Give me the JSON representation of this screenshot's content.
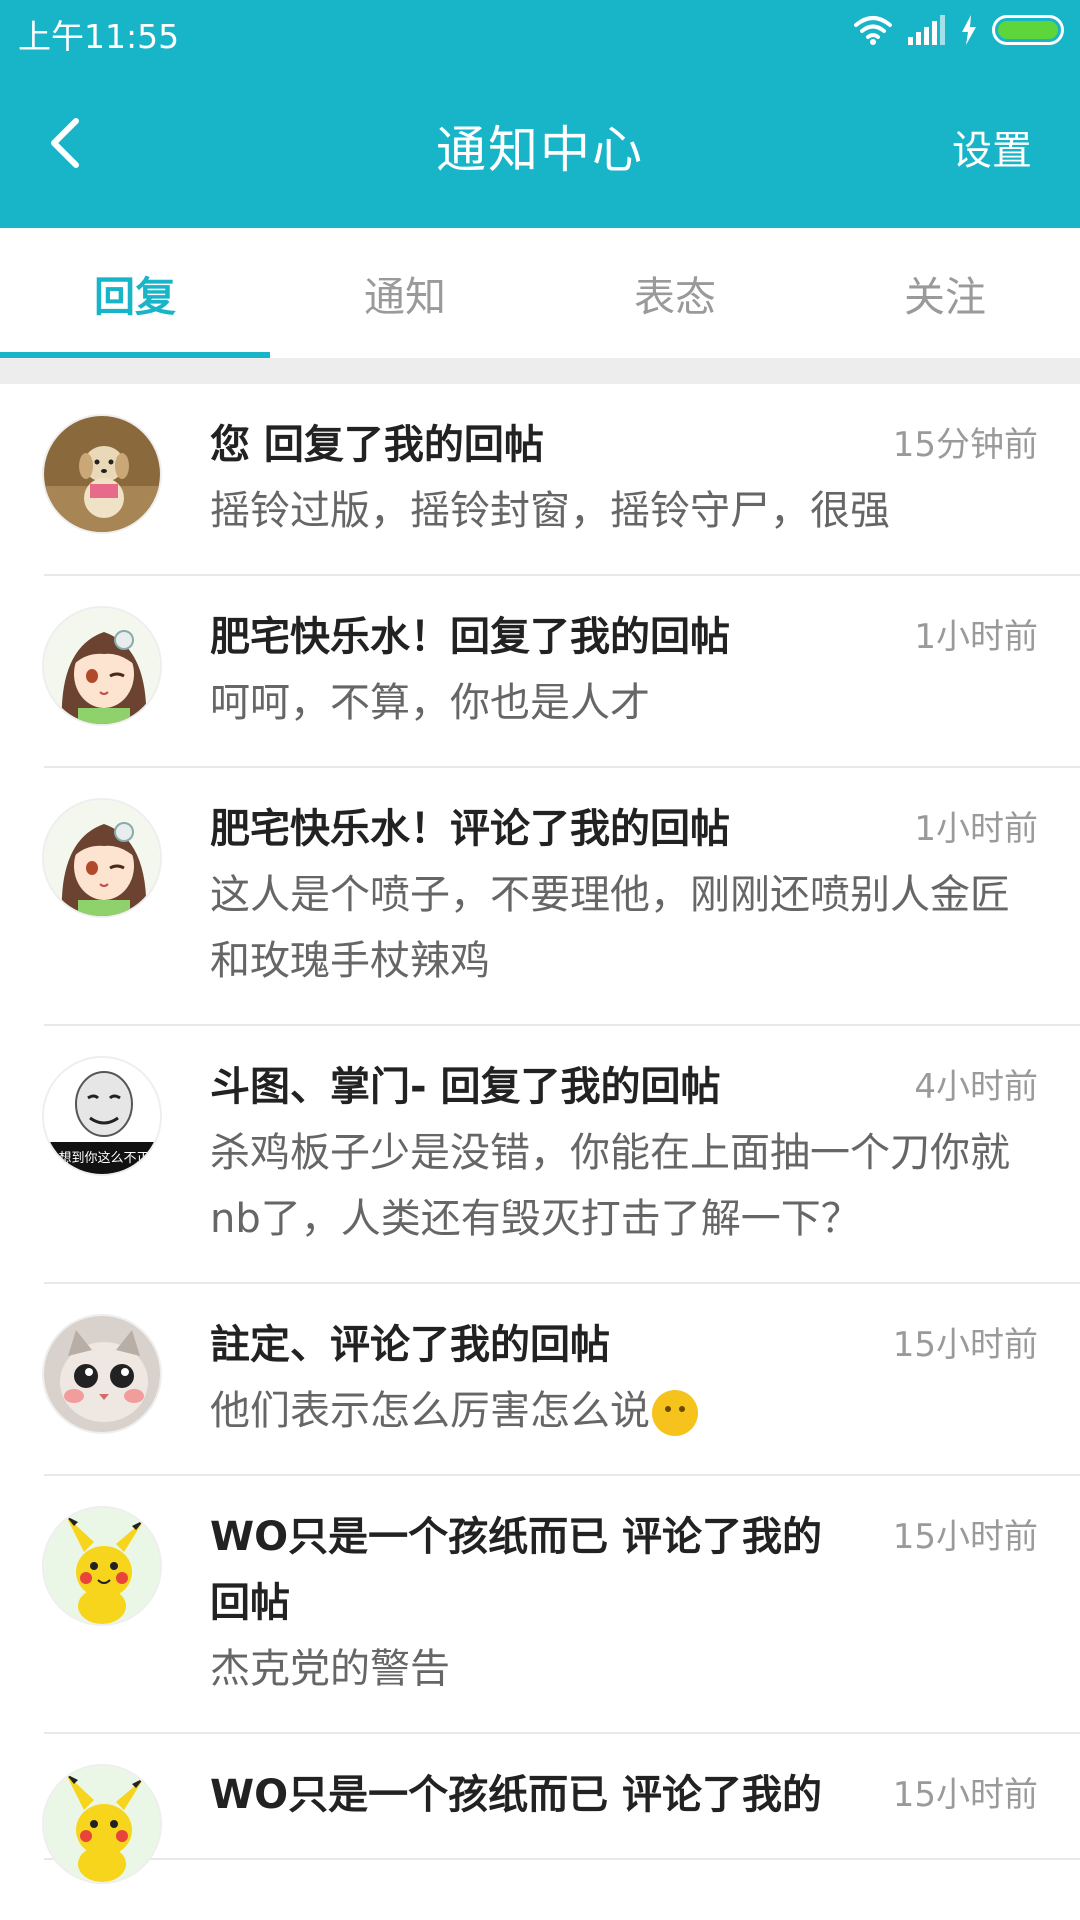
{
  "status_bar": {
    "time": "上午11:55"
  },
  "header": {
    "title": "通知中心",
    "settings_label": "设置"
  },
  "tabs": [
    {
      "label": "回复",
      "active": true
    },
    {
      "label": "通知",
      "active": false
    },
    {
      "label": "表态",
      "active": false
    },
    {
      "label": "关注",
      "active": false
    }
  ],
  "colors": {
    "accent": "#18b4c8",
    "battery": "#5cd63a"
  },
  "notifications": [
    {
      "title": "您 回复了我的回帖",
      "time": "15分钟前",
      "text": "摇铃过版，摇铃封窗，摇铃守尸，很强",
      "avatar": "puppy-avatar"
    },
    {
      "title": "肥宅快乐水！回复了我的回帖",
      "time": "1小时前",
      "text": "呵呵，不算，你也是人才",
      "avatar": "anime-girl-avatar"
    },
    {
      "title": "肥宅快乐水！评论了我的回帖",
      "time": "1小时前",
      "text": "这人是个喷子，不要理他，刚刚还喷别人金匠和玫瑰手杖辣鸡",
      "avatar": "anime-girl-avatar"
    },
    {
      "title": "斗图、掌门- 回复了我的回帖",
      "time": "4小时前",
      "text": "杀鸡板子少是没错，你能在上面抽一个刀你就nb了，人类还有毁灭打击了解一下？",
      "avatar": "meme-face-avatar",
      "avatar_caption": "没想到你这么不正经"
    },
    {
      "title": "註定、评论了我的回帖",
      "time": "15小时前",
      "text": "他们表示怎么厉害怎么说",
      "emoji": "blush-emoji",
      "avatar": "cat-avatar"
    },
    {
      "title": "WO只是一个孩纸而已 评论了我的回帖",
      "time": "15小时前",
      "text": "杰克党的警告",
      "avatar": "pikachu-avatar"
    },
    {
      "title": "WO只是一个孩纸而已 评论了我的",
      "time": "15小时前",
      "text": "",
      "avatar": "pikachu-avatar"
    }
  ]
}
